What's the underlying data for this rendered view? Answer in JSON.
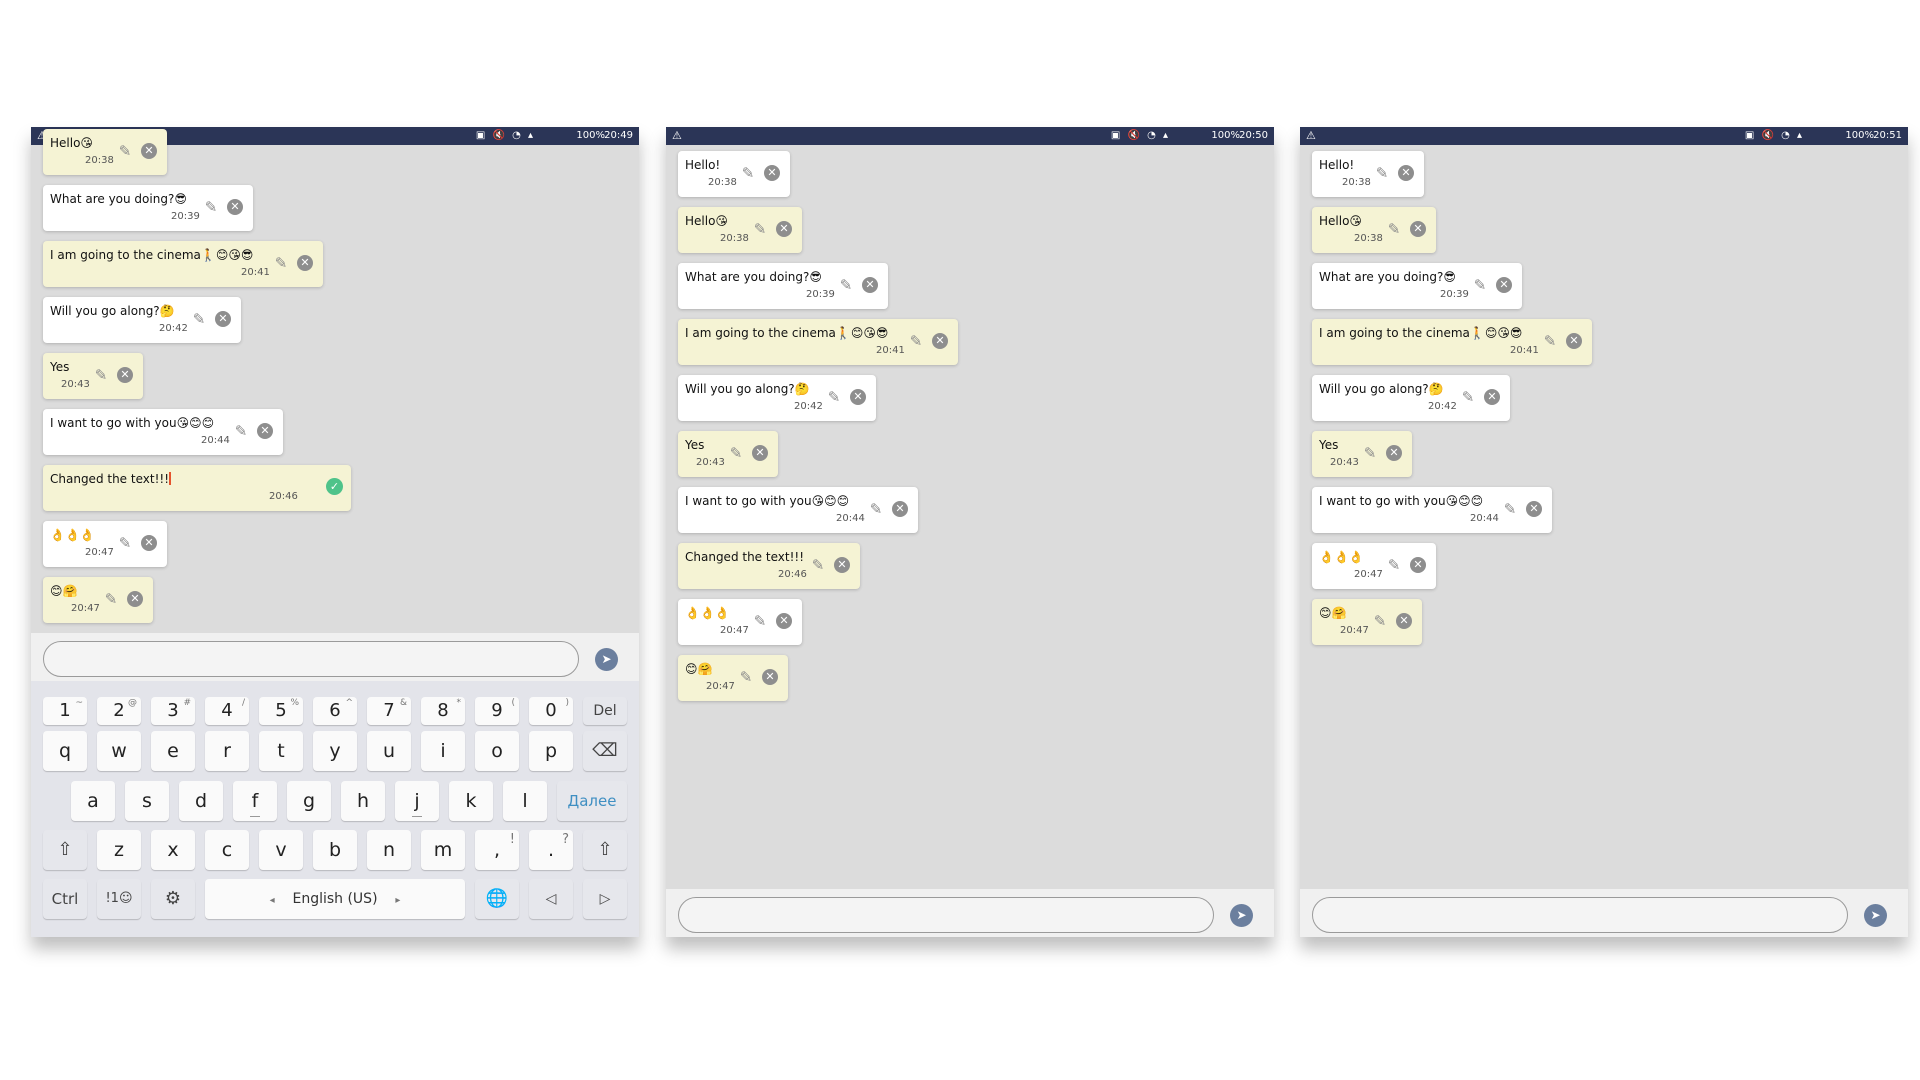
{
  "screens": [
    {
      "status": {
        "warning_icon": "warning-triangle-icon",
        "battery": "100%",
        "time": "20:49"
      },
      "messages": [
        {
          "text": "Hello😘",
          "time": "20:38",
          "style": "yellow"
        },
        {
          "text": "What are you doing?😎",
          "time": "20:39",
          "style": "white"
        },
        {
          "text": "I am going to the cinema🚶😊😘😎",
          "time": "20:41",
          "style": "yellow"
        },
        {
          "text": "Will you go along?🤔",
          "time": "20:42",
          "style": "white"
        },
        {
          "text": "Yes",
          "time": "20:43",
          "style": "yellow"
        },
        {
          "text": "I want to go with you😘😊😊",
          "time": "20:44",
          "style": "white"
        },
        {
          "text": "Changed the text!!!",
          "time": "20:46",
          "style": "yellow",
          "editing": true
        },
        {
          "text": "👌👌👌",
          "time": "20:47",
          "style": "white"
        },
        {
          "text": "😊🤗",
          "time": "20:47",
          "style": "yellow"
        }
      ],
      "input_placeholder": "",
      "keyboard": {
        "number_row": [
          {
            "k": "1",
            "s": "~"
          },
          {
            "k": "2",
            "s": "@"
          },
          {
            "k": "3",
            "s": "#"
          },
          {
            "k": "4",
            "s": "/"
          },
          {
            "k": "5",
            "s": "%"
          },
          {
            "k": "6",
            "s": "^"
          },
          {
            "k": "7",
            "s": "&"
          },
          {
            "k": "8",
            "s": "*"
          },
          {
            "k": "9",
            "s": "("
          },
          {
            "k": "0",
            "s": ")"
          }
        ],
        "del_label": "Del",
        "row1": [
          "q",
          "w",
          "e",
          "r",
          "t",
          "y",
          "u",
          "i",
          "o",
          "p"
        ],
        "row2": [
          "a",
          "s",
          "d",
          "f",
          "g",
          "h",
          "j",
          "k",
          "l"
        ],
        "enter_label": "Далее",
        "row3": [
          "z",
          "x",
          "c",
          "v",
          "b",
          "n",
          "m"
        ],
        "comma_key": ",",
        "comma_sup": "!",
        "period_key": ".",
        "period_sup": "?",
        "ctrl_label": "Ctrl",
        "symbols_label": "!1☺",
        "space_label": "English (US)"
      }
    },
    {
      "status": {
        "warning_icon": "warning-triangle-icon",
        "battery": "100%",
        "time": "20:50"
      },
      "messages": [
        {
          "text": "Hello!",
          "time": "20:38",
          "style": "white"
        },
        {
          "text": "Hello😘",
          "time": "20:38",
          "style": "yellow"
        },
        {
          "text": "What are you doing?😎",
          "time": "20:39",
          "style": "white"
        },
        {
          "text": "I am going to the cinema🚶😊😘😎",
          "time": "20:41",
          "style": "yellow"
        },
        {
          "text": "Will you go along?🤔",
          "time": "20:42",
          "style": "white"
        },
        {
          "text": "Yes",
          "time": "20:43",
          "style": "yellow"
        },
        {
          "text": "I want to go with you😘😊😊",
          "time": "20:44",
          "style": "white"
        },
        {
          "text": "Changed the text!!!",
          "time": "20:46",
          "style": "yellow"
        },
        {
          "text": "👌👌👌",
          "time": "20:47",
          "style": "white"
        },
        {
          "text": "😊🤗",
          "time": "20:47",
          "style": "yellow"
        }
      ],
      "input_placeholder": ""
    },
    {
      "status": {
        "warning_icon": "warning-triangle-icon",
        "battery": "100%",
        "time": "20:51"
      },
      "messages": [
        {
          "text": "Hello!",
          "time": "20:38",
          "style": "white"
        },
        {
          "text": "Hello😘",
          "time": "20:38",
          "style": "yellow"
        },
        {
          "text": "What are you doing?😎",
          "time": "20:39",
          "style": "white"
        },
        {
          "text": "I am going to the cinema🚶😊😘😎",
          "time": "20:41",
          "style": "yellow"
        },
        {
          "text": "Will you go along?🤔",
          "time": "20:42",
          "style": "white"
        },
        {
          "text": "Yes",
          "time": "20:43",
          "style": "yellow"
        },
        {
          "text": "I want to go with you😘😊😊",
          "time": "20:44",
          "style": "white"
        },
        {
          "text": "👌👌👌",
          "time": "20:47",
          "style": "white"
        },
        {
          "text": "😊🤗",
          "time": "20:47",
          "style": "yellow"
        }
      ],
      "input_placeholder": ""
    }
  ],
  "colors": {
    "status_bar": "#2b3557",
    "chat_background": "#dcdcdc",
    "bubble_white": "#ffffff",
    "bubble_yellow": "#f5f3d4",
    "send_button": "#6b7f9e",
    "confirm_check": "#4fc38a",
    "enter_key_text": "#3f8fc2"
  },
  "icons": {
    "edit": "pencil-icon",
    "delete": "close-circle-icon",
    "confirm": "check-circle-icon",
    "send": "send-icon",
    "backspace": "backspace-icon",
    "shift": "shift-icon",
    "settings": "gear-icon",
    "language": "globe-icon",
    "cursor_left": "arrow-left-icon",
    "cursor_right": "arrow-right-icon"
  }
}
